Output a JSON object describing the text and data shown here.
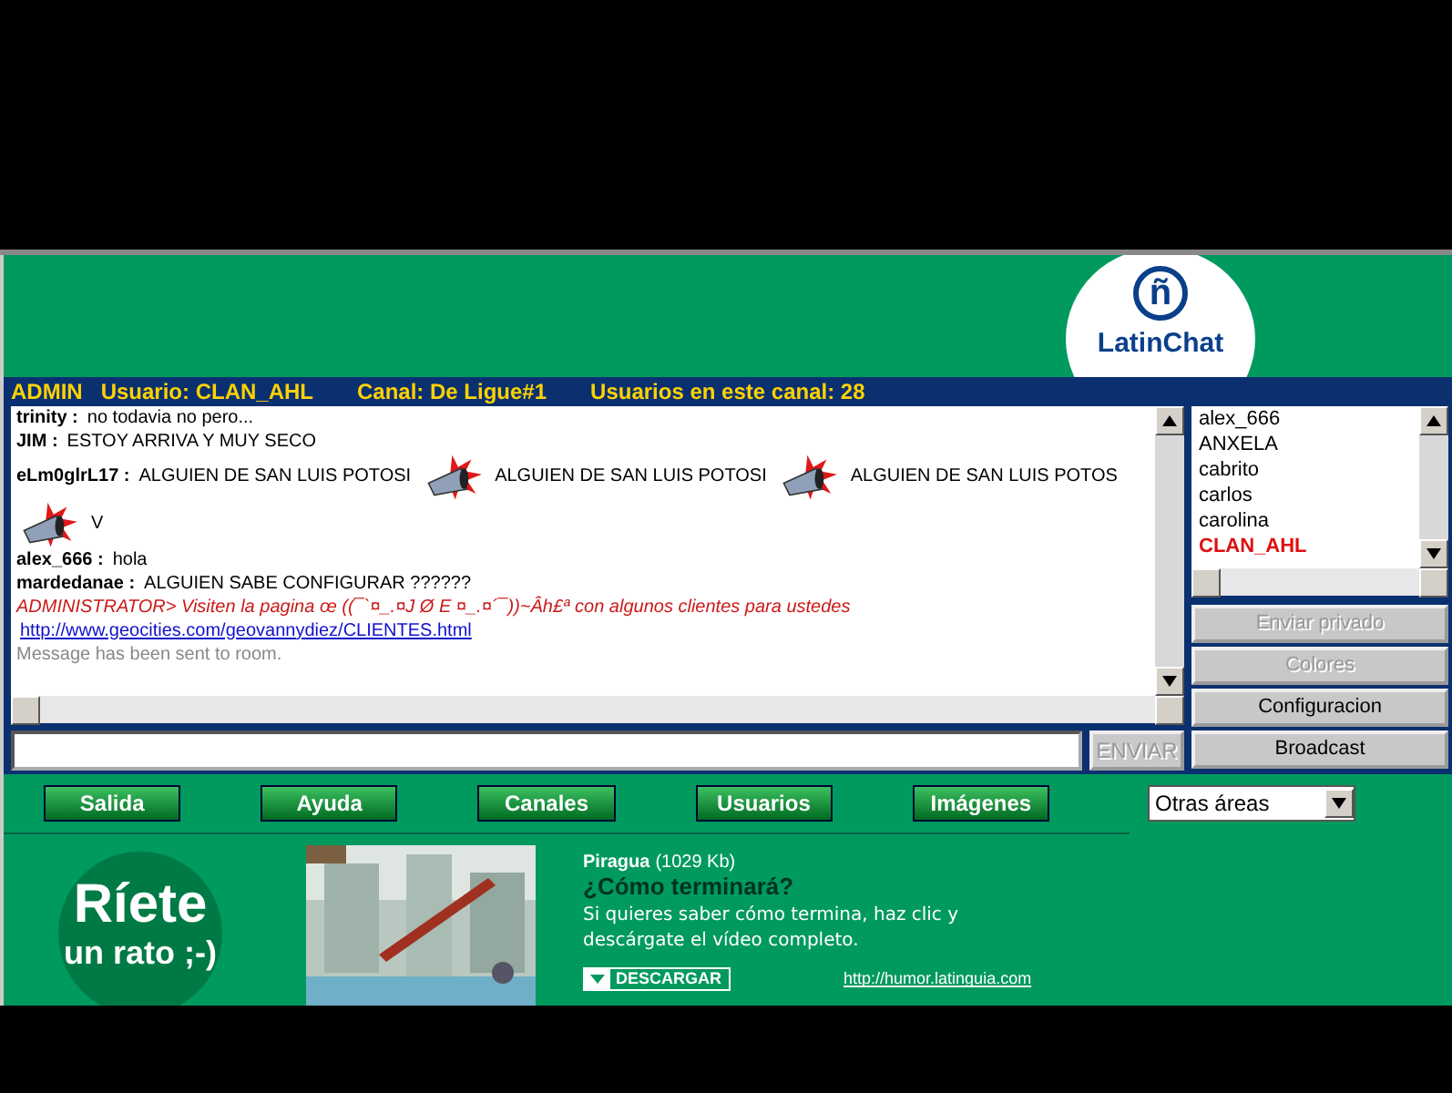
{
  "logo": {
    "mark": "ñ",
    "name": "LatinChat"
  },
  "info_bar": {
    "role": "ADMIN",
    "user": "Usuario: CLAN_AHL",
    "channel": "Canal: De Ligue#1",
    "count": "Usuarios en este canal: 28"
  },
  "messages": [
    {
      "kind": "message",
      "user": "trinity :",
      "parts": [
        {
          "kind": "text",
          "text": "no todavia no pero..."
        }
      ]
    },
    {
      "kind": "message",
      "user": "JIM :",
      "parts": [
        {
          "kind": "text",
          "text": "ESTOY ARRIVA Y MUY SECO"
        }
      ]
    },
    {
      "kind": "message",
      "user": "eLm0glrL17 :",
      "parts": [
        {
          "kind": "text",
          "text": "ALGUIEN DE SAN LUIS POTOSI"
        },
        {
          "kind": "icon"
        },
        {
          "kind": "text",
          "text": "ALGUIEN DE SAN LUIS POTOSI"
        },
        {
          "kind": "icon"
        },
        {
          "kind": "text",
          "text": "ALGUIEN DE SAN LUIS POTOS"
        }
      ]
    },
    {
      "kind": "message",
      "parts": [
        {
          "kind": "icon"
        },
        {
          "kind": "text",
          "text": "V"
        }
      ]
    },
    {
      "kind": "message",
      "user": "alex_666 :",
      "parts": [
        {
          "kind": "text",
          "text": "hola"
        }
      ]
    },
    {
      "kind": "message",
      "user": "mardedanae :",
      "parts": [
        {
          "kind": "text",
          "text": "ALGUIEN SABE CONFIGURAR ??????"
        }
      ]
    },
    {
      "kind": "admin",
      "text": "ADMINISTRATOR> Visiten la pagina œ ((¯`¤_.¤J Ø E ¤_.¤´¯))~Âh£ª con algunos clientes para ustedes"
    },
    {
      "kind": "link",
      "text": "http://www.geocities.com/geovannydiez/CLIENTES.html"
    },
    {
      "kind": "system",
      "text": "Message has been sent to room."
    }
  ],
  "send_button": {
    "label": "ENVIAR",
    "disabled": true
  },
  "users": [
    {
      "name": "alex_666",
      "self": false
    },
    {
      "name": "ANXELA",
      "self": false
    },
    {
      "name": "cabrito",
      "self": false
    },
    {
      "name": "carlos",
      "self": false
    },
    {
      "name": "carolina",
      "self": false
    },
    {
      "name": "CLAN_AHL",
      "self": true
    }
  ],
  "side_buttons": [
    {
      "label": "Enviar privado",
      "disabled": true
    },
    {
      "label": "Colores",
      "disabled": true
    },
    {
      "label": "Configuracion",
      "disabled": false
    },
    {
      "label": "Broadcast",
      "disabled": false
    }
  ],
  "nav_buttons": [
    "Salida",
    "Ayuda",
    "Canales",
    "Usuarios",
    "Imágenes"
  ],
  "areas_select": {
    "value": "Otras áreas"
  },
  "ad": {
    "slogan_1": "Ríete",
    "slogan_2": "un rato ;-)",
    "title": "Piragua",
    "size": "(1029 Kb)",
    "headline": "¿Cómo terminará?",
    "body": "Si quieres saber cómo termina, haz clic y descárgate el vídeo completo.",
    "download": "DESCARGAR",
    "link": "http://humor.latinguia.com"
  }
}
